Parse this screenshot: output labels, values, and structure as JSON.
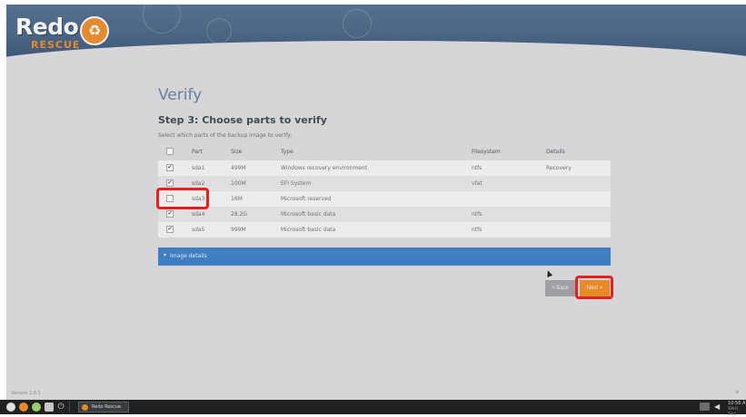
{
  "app": {
    "logo_text": "Redo",
    "logo_sub": "RESCUE",
    "version": "Version 2.0.1"
  },
  "page": {
    "title": "Verify",
    "step_title": "Step 3: Choose parts to verify",
    "hint": "Select which parts of the backup image to verify:"
  },
  "table": {
    "columns": [
      "Part",
      "Size",
      "Type",
      "Filesystem",
      "Details"
    ],
    "rows": [
      {
        "checked": true,
        "part": "sda1",
        "size": "499M",
        "type": "Windows recovery environment",
        "fs": "ntfs",
        "details": "Recovery"
      },
      {
        "checked": true,
        "part": "sda2",
        "size": "100M",
        "type": "EFI System",
        "fs": "vfat",
        "details": ""
      },
      {
        "checked": false,
        "part": "sda3",
        "size": "16M",
        "type": "Microsoft reserved",
        "fs": "",
        "details": ""
      },
      {
        "checked": true,
        "part": "sda4",
        "size": "28.2G",
        "type": "Microsoft basic data",
        "fs": "ntfs",
        "details": ""
      },
      {
        "checked": true,
        "part": "sda5",
        "size": "999M",
        "type": "Microsoft basic data",
        "fs": "ntfs",
        "details": ""
      }
    ]
  },
  "details_bar": {
    "label": "Image details",
    "arrow": "▾"
  },
  "buttons": {
    "back": "< Back",
    "next": "Next >"
  },
  "taskbar": {
    "task_label": "Redo Rescue",
    "clock_time": "10:56 A",
    "clock_date": "Wed Sep"
  },
  "glyphs": {
    "check": "✔",
    "uncheck": "",
    "power": "⏻",
    "volume": "◀",
    "resize": "⇲",
    "recycle": "♻"
  },
  "colors": {
    "accent_orange": "#e68a2a",
    "bar_blue": "#3f7fc1",
    "highlight_red": "#e81f1f",
    "header_blue": "#4b6584"
  }
}
